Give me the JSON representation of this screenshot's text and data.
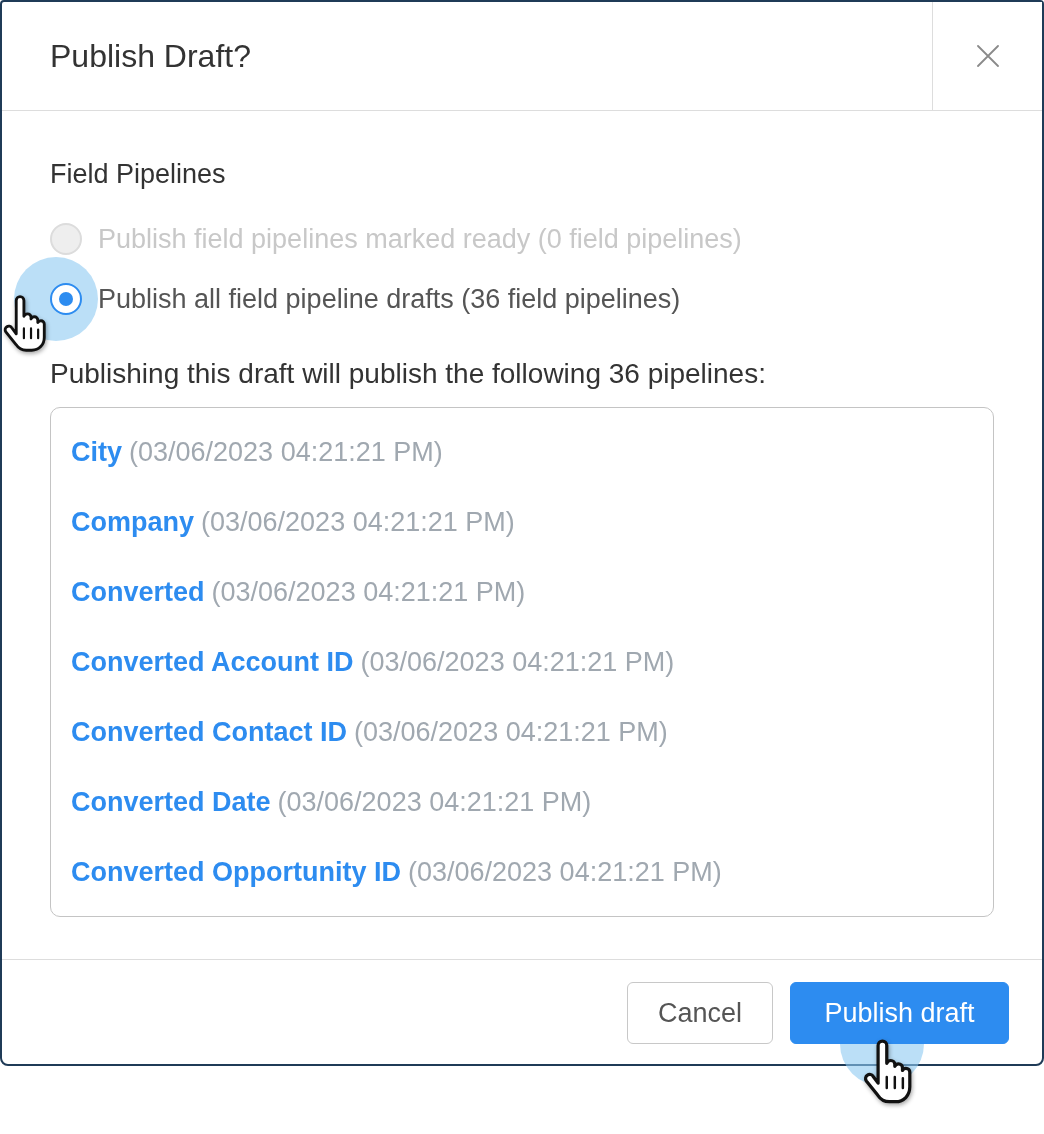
{
  "dialog": {
    "title": "Publish Draft?"
  },
  "section_label": "Field Pipelines",
  "options": [
    {
      "label": "Publish field pipelines marked ready (0 field pipelines)",
      "selected": false,
      "disabled": true,
      "cursor_shown": false
    },
    {
      "label": "Publish all field pipeline drafts (36 field pipelines)",
      "selected": true,
      "disabled": false,
      "cursor_shown": true
    }
  ],
  "summary": "Publishing this draft will publish the following 36 pipelines:",
  "pipelines": [
    {
      "name": "City",
      "timestamp": "(03/06/2023 04:21:21 PM)"
    },
    {
      "name": "Company",
      "timestamp": "(03/06/2023 04:21:21 PM)"
    },
    {
      "name": "Converted",
      "timestamp": "(03/06/2023 04:21:21 PM)"
    },
    {
      "name": "Converted Account ID",
      "timestamp": "(03/06/2023 04:21:21 PM)"
    },
    {
      "name": "Converted Contact ID",
      "timestamp": "(03/06/2023 04:21:21 PM)"
    },
    {
      "name": "Converted Date",
      "timestamp": "(03/06/2023 04:21:21 PM)"
    },
    {
      "name": "Converted Opportunity ID",
      "timestamp": "(03/06/2023 04:21:21 PM)"
    }
  ],
  "buttons": [
    {
      "label": "Cancel",
      "kind": "secondary",
      "cursor_shown": false
    },
    {
      "label": "Publish draft",
      "kind": "primary",
      "cursor_shown": true
    }
  ]
}
